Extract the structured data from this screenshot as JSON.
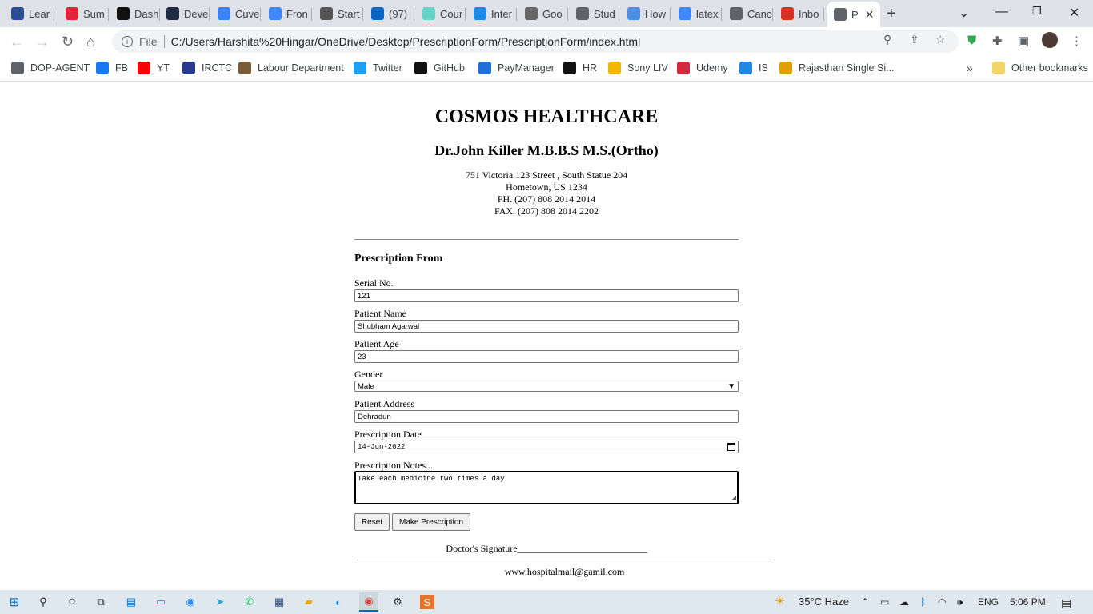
{
  "tabs": [
    {
      "label": "Lear",
      "icon": "udacity-icon",
      "color": "#2a4e96"
    },
    {
      "label": "Sum",
      "icon": "opera-icon",
      "color": "#e0253b"
    },
    {
      "label": "Dash",
      "icon": "hackerrank-icon",
      "color": "#111111"
    },
    {
      "label": "Deve",
      "icon": "hashnode-icon",
      "color": "#1f2b43"
    },
    {
      "label": "Cuve",
      "icon": "cuvette-icon",
      "color": "#3b82f6"
    },
    {
      "label": "Fron",
      "icon": "docs-icon",
      "color": "#4285f4"
    },
    {
      "label": "Start",
      "icon": "peace-icon",
      "color": "#555555"
    },
    {
      "label": "(97)",
      "icon": "linkedin-icon",
      "color": "#0a66c2"
    },
    {
      "label": "Cour",
      "icon": "course-icon",
      "color": "#6ad1c8"
    },
    {
      "label": "Inter",
      "icon": "is-icon",
      "color": "#1e88e5"
    },
    {
      "label": "Goo",
      "icon": "chart-icon",
      "color": "#666666"
    },
    {
      "label": "Stud",
      "icon": "globe-icon",
      "color": "#5f6368"
    },
    {
      "label": "How",
      "icon": "infinity-icon",
      "color": "#4a90e2"
    },
    {
      "label": "latex",
      "icon": "google-icon",
      "color": "#4285f4"
    },
    {
      "label": "Canc",
      "icon": "globe-icon",
      "color": "#5f6368"
    },
    {
      "label": "Inbo",
      "icon": "gmail-icon",
      "color": "#d93025"
    },
    {
      "label": "P",
      "icon": "globe-icon",
      "color": "#5f6368",
      "active": true
    }
  ],
  "address_bar": {
    "scheme_label": "File",
    "url": "C:/Users/Harshita%20Hingar/OneDrive/Desktop/PrescriptionForm/PrescriptionForm/index.html"
  },
  "bookmarks": [
    {
      "label": "DOP-AGENT",
      "icon": "globe-icon",
      "color": "#5f6368"
    },
    {
      "label": "FB",
      "icon": "facebook-icon",
      "color": "#1877f2"
    },
    {
      "label": "YT",
      "icon": "youtube-icon",
      "color": "#ff0000"
    },
    {
      "label": "IRCTC",
      "icon": "irctc-icon",
      "color": "#2a3b8f"
    },
    {
      "label": "Labour Department",
      "icon": "emblem-icon",
      "color": "#7a5c3a"
    },
    {
      "label": "Twitter",
      "icon": "twitter-icon",
      "color": "#1da1f2"
    },
    {
      "label": "GitHub",
      "icon": "github-icon",
      "color": "#111111"
    },
    {
      "label": "PayManager",
      "icon": "paymanager-icon",
      "color": "#1e6fd9"
    },
    {
      "label": "HR",
      "icon": "hackerrank-icon",
      "color": "#111111"
    },
    {
      "label": "Sony LIV",
      "icon": "sonyliv-icon",
      "color": "#f2b705"
    },
    {
      "label": "Udemy",
      "icon": "udemy-icon",
      "color": "#d3293f"
    },
    {
      "label": "IS",
      "icon": "is-icon",
      "color": "#1e88e5"
    },
    {
      "label": "Rajasthan Single Si...",
      "icon": "rajasthan-icon",
      "color": "#e0a100"
    }
  ],
  "other_bookmarks": "Other bookmarks",
  "page": {
    "hospital_name": "COSMOS HEALTHCARE",
    "doctor_name": "Dr.John Killer M.B.B.S M.S.(Ortho)",
    "address_lines": [
      "751 Victoria 123 Street , South Statue 204",
      "Hometown, US 1234",
      "PH. (207) 808 2014 2014",
      "FAX. (207) 808 2014 2202"
    ],
    "form_heading": "Prescription From",
    "fields": {
      "serial": {
        "label": "Serial No.",
        "value": "121"
      },
      "patient_name": {
        "label": "Patient Name",
        "value": "Shubham Agarwal"
      },
      "patient_age": {
        "label": "Patient Age",
        "value": "23"
      },
      "gender": {
        "label": "Gender",
        "value": "Male"
      },
      "address": {
        "label": "Patient Address",
        "value": "Dehradun"
      },
      "date": {
        "label": "Prescription Date",
        "value": "14-Jun-2022"
      },
      "notes": {
        "label": "Prescription Notes...",
        "value": "Take each medicine two times a day"
      }
    },
    "buttons": {
      "reset": "Reset",
      "submit": "Make Prescription"
    },
    "signature": "Doctor's Signature___________________________",
    "footer_email": "www.hospitalmail@gamil.com"
  },
  "taskbar": {
    "weather": "35°C  Haze",
    "language": "ENG",
    "time": "5:06 PM"
  }
}
